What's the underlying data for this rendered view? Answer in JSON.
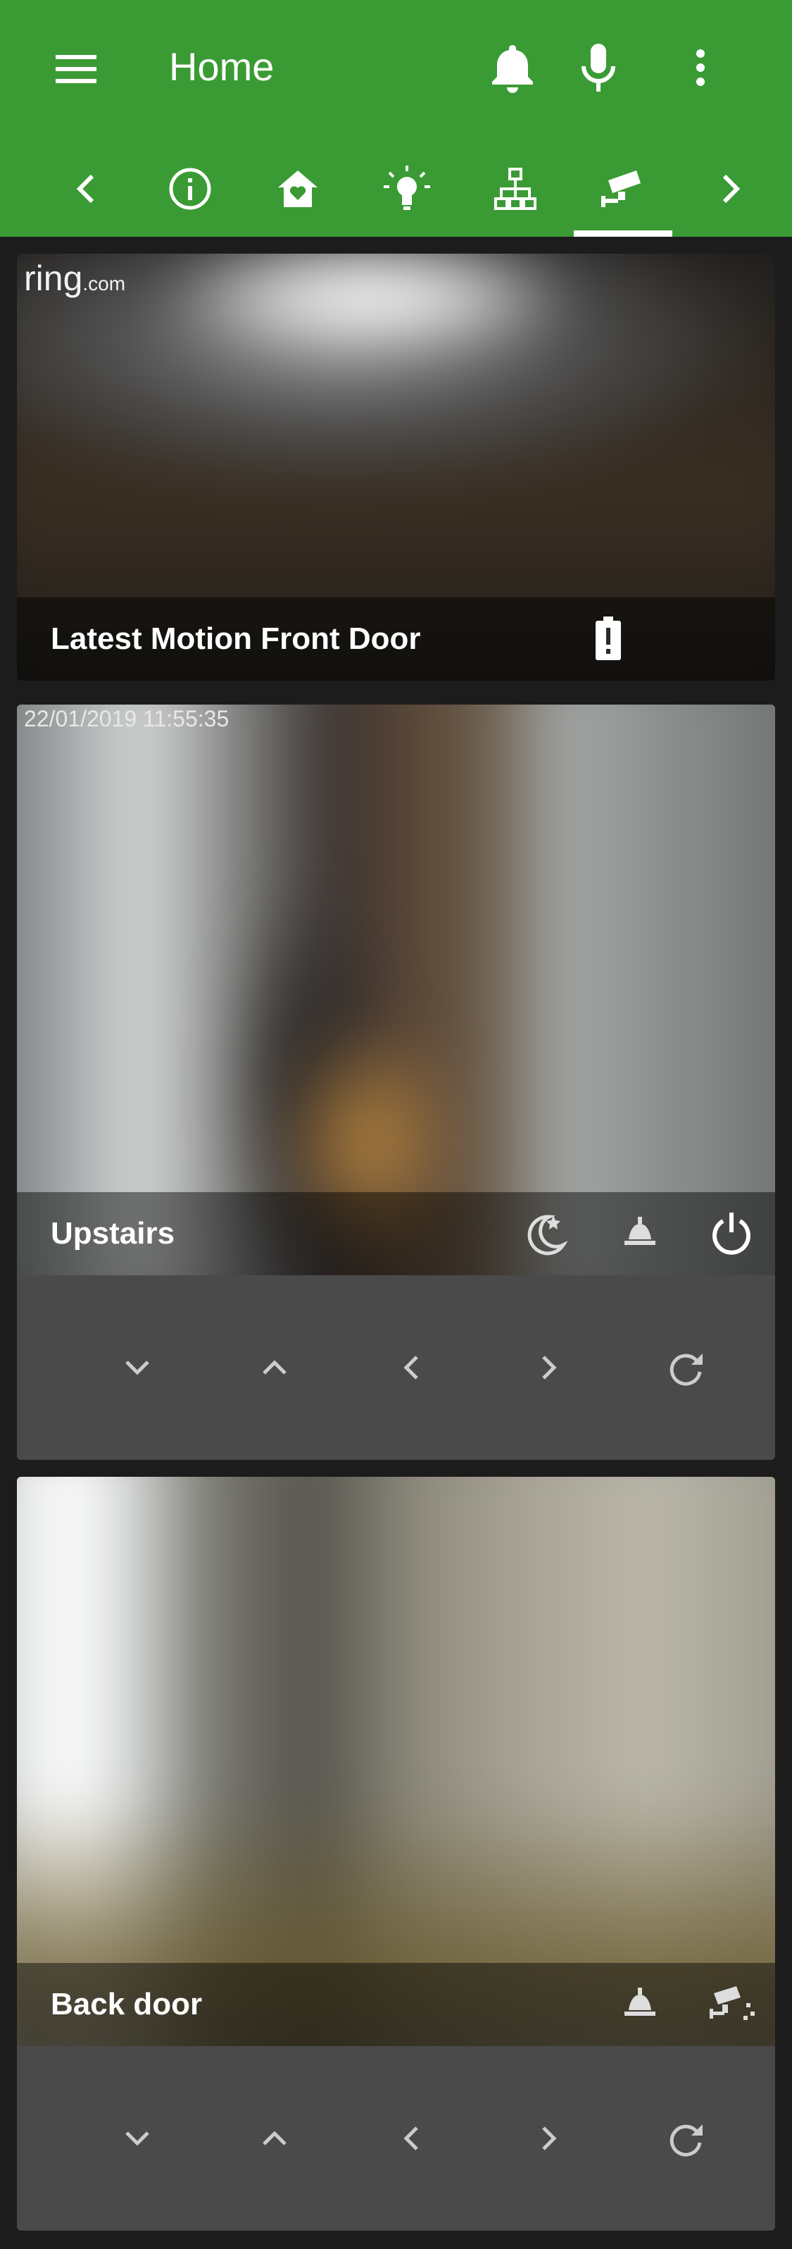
{
  "header": {
    "title": "Home",
    "bar_color": "#3a9b34",
    "icons": [
      "menu-icon",
      "bell-icon",
      "microphone-icon",
      "more-vert-icon"
    ]
  },
  "tabs": {
    "items": [
      "chevron-left-icon",
      "info-icon",
      "home-heart-icon",
      "lightbulb-icon",
      "network-icon",
      "cctv-icon",
      "chevron-right-icon"
    ],
    "active": "cctv-icon"
  },
  "cards": [
    {
      "title": "Latest Motion Front Door",
      "watermark_brand": "ring",
      "watermark_suffix": ".com",
      "icons": [
        "battery-alert-icon"
      ]
    },
    {
      "title": "Upstairs",
      "timestamp": "22/01/2019 11:55:35",
      "icons": [
        "night-mode-icon",
        "lamp-icon",
        "power-icon"
      ],
      "controls": [
        "chevron-down-icon",
        "chevron-up-icon",
        "chevron-left-icon",
        "chevron-right-icon",
        "refresh-icon"
      ]
    },
    {
      "title": "Back door",
      "icons": [
        "lamp-icon",
        "cctv-off-icon"
      ],
      "controls": [
        "chevron-down-icon",
        "chevron-up-icon",
        "chevron-left-icon",
        "chevron-right-icon",
        "refresh-icon"
      ]
    }
  ]
}
